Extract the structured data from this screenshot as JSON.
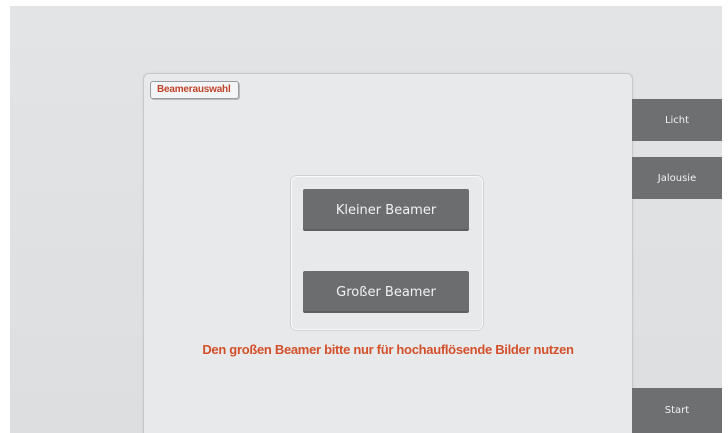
{
  "panel": {
    "tab_label": "Beamerauswahl",
    "buttons": {
      "small_beamer": "Kleiner Beamer",
      "large_beamer": "Großer Beamer"
    },
    "notice": "Den großen Beamer bitte nur für hochauflösende Bilder nutzen"
  },
  "side_menu": {
    "licht": "Licht",
    "jalousie": "Jalousie",
    "start": "Start"
  },
  "colors": {
    "accent_text": "#d4502b",
    "button_bg": "#6b6d6f",
    "background": "#e2e4e6"
  }
}
